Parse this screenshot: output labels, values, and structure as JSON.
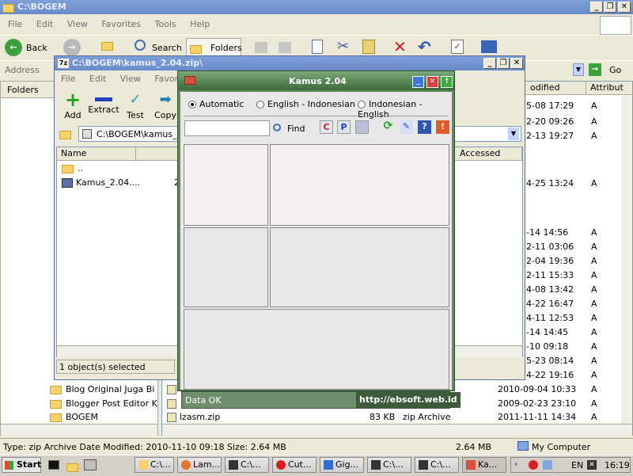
{
  "explorer": {
    "title": "C:\\BOGEM",
    "menu": [
      "File",
      "Edit",
      "View",
      "Favorites",
      "Tools",
      "Help"
    ],
    "toolbar": {
      "back": "Back",
      "search": "Search",
      "folders": "Folders"
    },
    "address_label": "Address",
    "go_label": "Go",
    "folders_pane_label": "Folders",
    "folders": [
      "Blog Original Juga Bi",
      "Blogger Post Editor K",
      "BOGEM"
    ],
    "columns": {
      "modified": "odified",
      "attrib": "Attribut"
    },
    "rows": [
      {
        "date": "5-08 17:29",
        "attr": "A"
      },
      {
        "date": "2-20 09:26",
        "attr": "A"
      },
      {
        "date": "2-13 19:27",
        "attr": "A"
      },
      {
        "date": "4-25 13:24",
        "attr": "A"
      },
      {
        "date": "-14 14:56",
        "attr": "A"
      },
      {
        "date": "2-11 03:06",
        "attr": "A"
      },
      {
        "date": "2-04 19:36",
        "attr": "A"
      },
      {
        "date": "2-11 15:33",
        "attr": "A"
      },
      {
        "date": "4-08 13:42",
        "attr": "A"
      },
      {
        "date": "4-22 16:47",
        "attr": "A"
      },
      {
        "date": "4-11 12:53",
        "attr": "A"
      },
      {
        "date": "-14 14:45",
        "attr": "A"
      },
      {
        "date": "-10 09:18",
        "attr": "A"
      },
      {
        "date": "5-23 08:14",
        "attr": "A"
      },
      {
        "date": "4-22 19:16",
        "attr": "A"
      }
    ],
    "bottom_rows": [
      {
        "date": "2010-09-04 10:33",
        "attr": "A"
      },
      {
        "date": "2009-02-23 23:10",
        "attr": "A"
      },
      {
        "name": "lzasm.zip",
        "size": "83 KB",
        "type": "zip Archive",
        "date": "2011-11-11 14:34",
        "attr": "A"
      }
    ],
    "status": {
      "text": "Type: zip Archive Date Modified: 2010-11-10 09:18 Size: 2.64 MB",
      "size": "2.64 MB",
      "zone": "My Computer"
    }
  },
  "sevenzip": {
    "title": "C:\\BOGEM\\kamus_2.04.zip\\",
    "menu": [
      "File",
      "Edit",
      "View",
      "Favorites"
    ],
    "toolbar": {
      "add": "Add",
      "extract": "Extract",
      "test": "Test",
      "copy": "Copy"
    },
    "path": "C:\\BOGEM\\kamus_2",
    "columns": {
      "name": "Name",
      "accessed": "Accessed"
    },
    "items": [
      "..",
      "Kamus_2.04...."
    ],
    "item_col": "2",
    "status": "1 object(s) selected"
  },
  "kamus": {
    "title": "Kamus 2.04",
    "modes": [
      "Automatic",
      "English - Indonesian",
      "Indonesian - English"
    ],
    "search_placeholder": "",
    "find_label": "Find",
    "btn_c": "C",
    "btn_p": "P",
    "btn_warn": "!",
    "btn_help": "?",
    "status": "Data OK",
    "url": "http://ebsoft.web.id"
  },
  "taskbar": {
    "start": "Start",
    "items": [
      "C:\\...",
      "Lam...",
      "C:\\...",
      "Cut...",
      "Gig...",
      "C:\\...",
      "C:\\...",
      "Ka..."
    ],
    "lang": "EN",
    "time": "16:19"
  },
  "colors": {
    "kamus_green": "#5f8d5c",
    "xp_blue": "#2452b8",
    "taskbar": "#d4d0c8"
  }
}
